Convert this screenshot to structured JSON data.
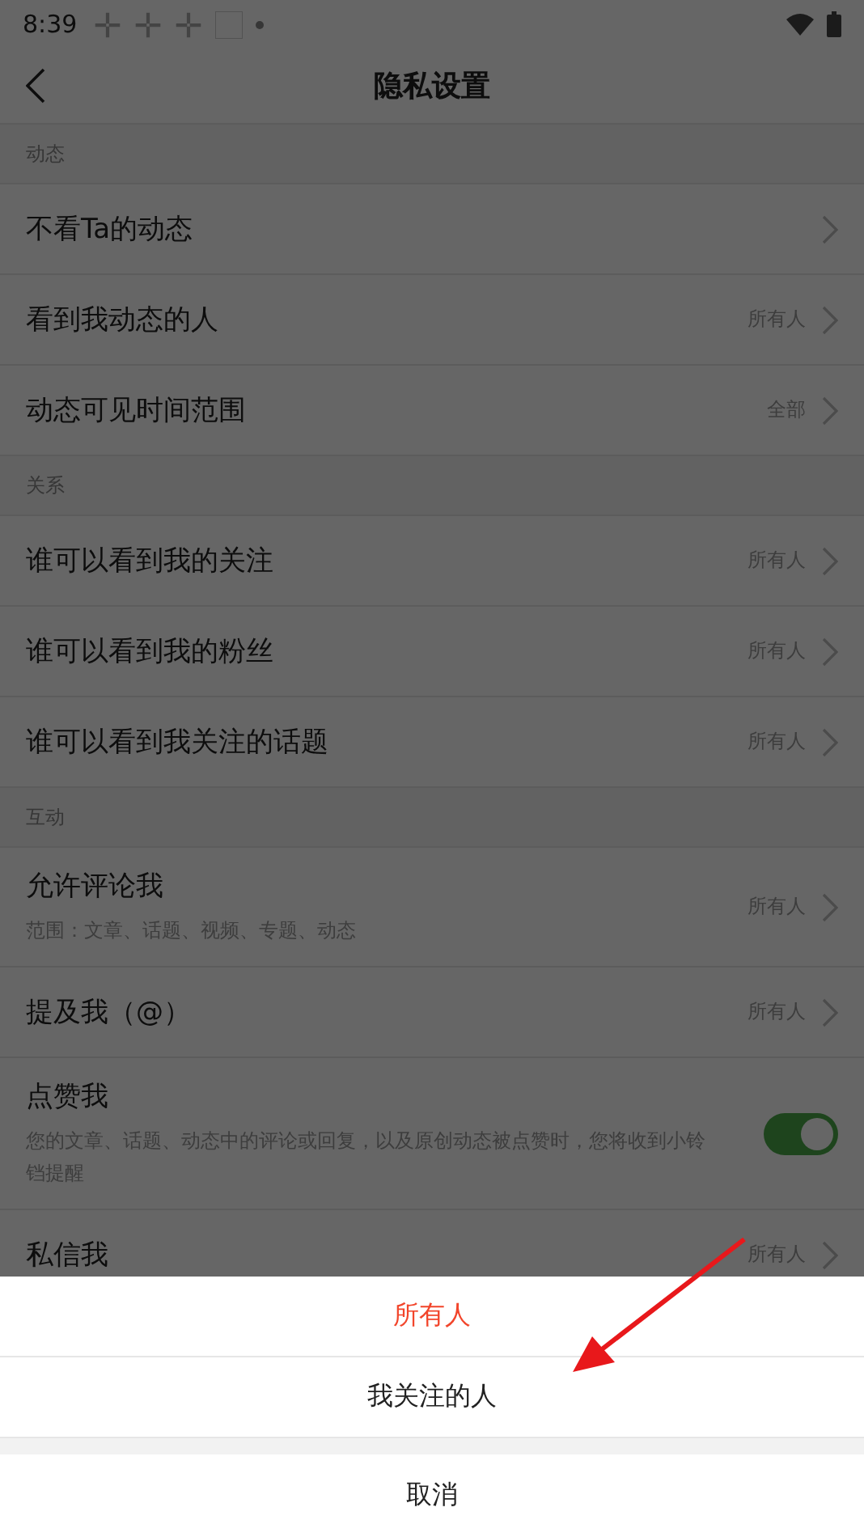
{
  "status_bar": {
    "time": "8:39"
  },
  "header": {
    "title": "隐私设置"
  },
  "sections": [
    {
      "title": "动态",
      "items": [
        {
          "kind": "link",
          "label": "不看Ta的动态"
        },
        {
          "kind": "link",
          "label": "看到我动态的人",
          "value": "所有人"
        },
        {
          "kind": "link",
          "label": "动态可见时间范围",
          "value": "全部"
        }
      ]
    },
    {
      "title": "关系",
      "items": [
        {
          "kind": "link",
          "label": "谁可以看到我的关注",
          "value": "所有人"
        },
        {
          "kind": "link",
          "label": "谁可以看到我的粉丝",
          "value": "所有人"
        },
        {
          "kind": "link",
          "label": "谁可以看到我关注的话题",
          "value": "所有人"
        }
      ]
    },
    {
      "title": "互动",
      "items": [
        {
          "kind": "link",
          "label": "允许评论我",
          "value": "所有人",
          "description": "范围：文章、话题、视频、专题、动态"
        },
        {
          "kind": "link",
          "label": "提及我（@）",
          "value": "所有人"
        },
        {
          "kind": "toggle",
          "label": "点赞我",
          "on": true,
          "description": "您的文章、话题、动态中的评论或回复，以及原创动态被点赞时，您将收到小铃铛提醒"
        },
        {
          "kind": "link",
          "label": "私信我",
          "value": "所有人"
        }
      ]
    }
  ],
  "sheet": {
    "options": [
      {
        "label": "所有人",
        "selected": true
      },
      {
        "label": "我关注的人",
        "selected": false
      }
    ],
    "cancel": "取消"
  }
}
